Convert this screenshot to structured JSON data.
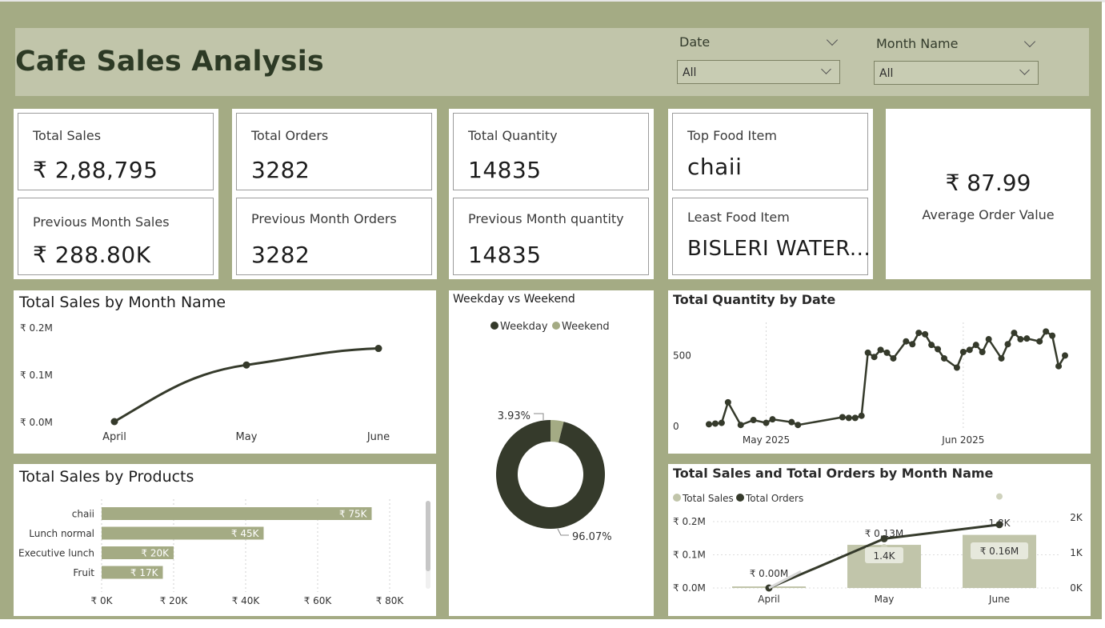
{
  "title": "Cafe Sales Analysis",
  "slicers": [
    {
      "label": "Date",
      "value": "All"
    },
    {
      "label": "Month Name",
      "value": "All"
    }
  ],
  "kpis": {
    "total_sales": {
      "label": "Total Sales",
      "value": "₹ 2,88,795"
    },
    "prev_month_sales": {
      "label": "Previous Month Sales",
      "value": "₹ 288.80K"
    },
    "total_orders": {
      "label": "Total Orders",
      "value": "3282"
    },
    "prev_month_orders": {
      "label": "Previous Month Orders",
      "value": "3282"
    },
    "total_quantity": {
      "label": "Total Quantity",
      "value": "14835"
    },
    "prev_month_quantity": {
      "label": "Previous Month quantity",
      "value": "14835"
    },
    "top_food": {
      "label": "Top Food Item",
      "value": "chaii"
    },
    "least_food": {
      "label": "Least Food Item",
      "value": "BISLERI WATER..."
    },
    "aov": {
      "label": "Average Order Value",
      "value": "₹ 87.99"
    }
  },
  "colors": {
    "dark": "#353a2b",
    "medium": "#a4ab84",
    "light": "#c1c5aa"
  },
  "chart_data": [
    {
      "type": "line",
      "title": "Total Sales by Month Name",
      "categories": [
        "April",
        "May",
        "June"
      ],
      "values": [
        0.0,
        0.12,
        0.155
      ],
      "yticks": [
        "₹ 0.0M",
        "₹ 0.1M",
        "₹ 0.2M"
      ],
      "ylim": [
        0,
        0.2
      ],
      "units": "M"
    },
    {
      "type": "bar",
      "title": "Total Sales by Products",
      "categories": [
        "chaii",
        "Lunch normal",
        "Executive lunch",
        "Fruit"
      ],
      "values": [
        75,
        45,
        20,
        17
      ],
      "labels": [
        "₹ 75K",
        "₹ 45K",
        "₹ 20K",
        "₹ 17K"
      ],
      "xticks": [
        "₹ 0K",
        "₹ 20K",
        "₹ 40K",
        "₹ 60K",
        "₹ 80K"
      ],
      "xlim": [
        0,
        80
      ],
      "units": "K"
    },
    {
      "type": "pie",
      "title": "Weekday vs Weekend",
      "legend": [
        "Weekday",
        "Weekend"
      ],
      "values": [
        96.07,
        3.93
      ],
      "labels": [
        "96.07%",
        "3.93%"
      ]
    },
    {
      "type": "line",
      "title": "Total Quantity by Date",
      "xticks": [
        "May 2025",
        "Jun 2025"
      ],
      "yticks": [
        "0",
        "500"
      ],
      "ylim": [
        0,
        700
      ],
      "x": [
        "2025-04-22",
        "2025-04-23",
        "2025-04-24",
        "2025-04-25",
        "2025-04-27",
        "2025-04-29",
        "2025-05-01",
        "2025-05-02",
        "2025-05-05",
        "2025-05-06",
        "2025-05-13",
        "2025-05-14",
        "2025-05-15",
        "2025-05-16",
        "2025-05-17",
        "2025-05-18",
        "2025-05-19",
        "2025-05-20",
        "2025-05-21",
        "2025-05-23",
        "2025-05-24",
        "2025-05-25",
        "2025-05-26",
        "2025-05-27",
        "2025-05-28",
        "2025-05-29",
        "2025-05-31",
        "2025-06-01",
        "2025-06-02",
        "2025-06-03",
        "2025-06-04",
        "2025-06-05",
        "2025-06-07",
        "2025-06-08",
        "2025-06-09",
        "2025-06-10",
        "2025-06-11",
        "2025-06-13",
        "2025-06-14",
        "2025-06-15",
        "2025-06-16",
        "2025-06-17"
      ],
      "values": [
        15,
        20,
        25,
        170,
        10,
        45,
        25,
        50,
        30,
        10,
        65,
        60,
        60,
        75,
        520,
        490,
        540,
        520,
        480,
        600,
        580,
        660,
        650,
        575,
        545,
        480,
        415,
        525,
        540,
        575,
        525,
        615,
        480,
        580,
        660,
        615,
        620,
        600,
        670,
        640,
        425,
        500
      ]
    },
    {
      "type": "bar",
      "title": "Total Sales and Total Orders by Month Name",
      "legend": [
        "Total Sales",
        "Total Orders"
      ],
      "categories": [
        "April",
        "May",
        "June"
      ],
      "series": [
        {
          "name": "Total Sales",
          "values": [
            0.0,
            0.13,
            0.16
          ],
          "labels": [
            "₹ 0.00M",
            "₹ 0.13M",
            "₹ 0.16M"
          ]
        },
        {
          "name": "Total Orders",
          "values": [
            0.0,
            1.4,
            1.8
          ],
          "labels": [
            "",
            "1.4K",
            "1.8K"
          ]
        }
      ],
      "yticks_left": [
        "₹ 0.0M",
        "₹ 0.1M",
        "₹ 0.2M"
      ],
      "yticks_right": [
        "0K",
        "1K",
        "2K"
      ],
      "ylim_left": [
        0,
        0.2
      ],
      "ylim_right": [
        0,
        2
      ]
    }
  ]
}
